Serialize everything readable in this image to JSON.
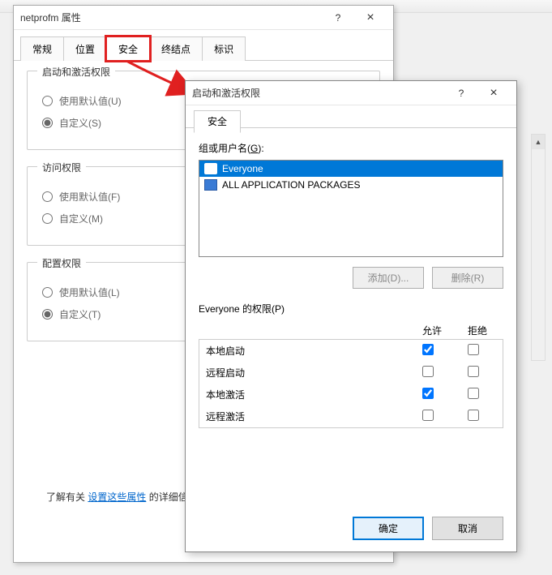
{
  "bg": {
    "fontsize_label": "14px"
  },
  "back": {
    "title": "netprofm 属性",
    "tabs": [
      "常规",
      "位置",
      "安全",
      "终结点",
      "标识"
    ],
    "active_tab_index": 2,
    "groups": {
      "launch": {
        "legend": "启动和激活权限",
        "opt_default": "使用默认值(U)",
        "opt_custom": "自定义(S)"
      },
      "access": {
        "legend": "访问权限",
        "opt_default": "使用默认值(F)",
        "opt_custom": "自定义(M)"
      },
      "config": {
        "legend": "配置权限",
        "opt_default": "使用默认值(L)",
        "opt_custom": "自定义(T)"
      }
    },
    "footer_prefix": "了解有关",
    "footer_link": "设置这些属性",
    "footer_suffix": "的详细信息。"
  },
  "front": {
    "title": "启动和激活权限",
    "tab": "安全",
    "group_label_pre": "组或用户名(",
    "group_label_u": "G",
    "group_label_post": "):",
    "users": [
      {
        "name": "Everyone",
        "selected": true,
        "icon": "users"
      },
      {
        "name": "ALL APPLICATION PACKAGES",
        "selected": false,
        "icon": "pkg"
      }
    ],
    "btn_add": "添加(D)...",
    "btn_remove": "删除(R)",
    "perm_label": "Everyone 的权限(P)",
    "col_allow": "允许",
    "col_deny": "拒绝",
    "perms": [
      {
        "name": "本地启动",
        "allow": true,
        "deny": false
      },
      {
        "name": "远程启动",
        "allow": false,
        "deny": false
      },
      {
        "name": "本地激活",
        "allow": true,
        "deny": false
      },
      {
        "name": "远程激活",
        "allow": false,
        "deny": false
      }
    ],
    "btn_ok": "确定",
    "btn_cancel": "取消"
  }
}
